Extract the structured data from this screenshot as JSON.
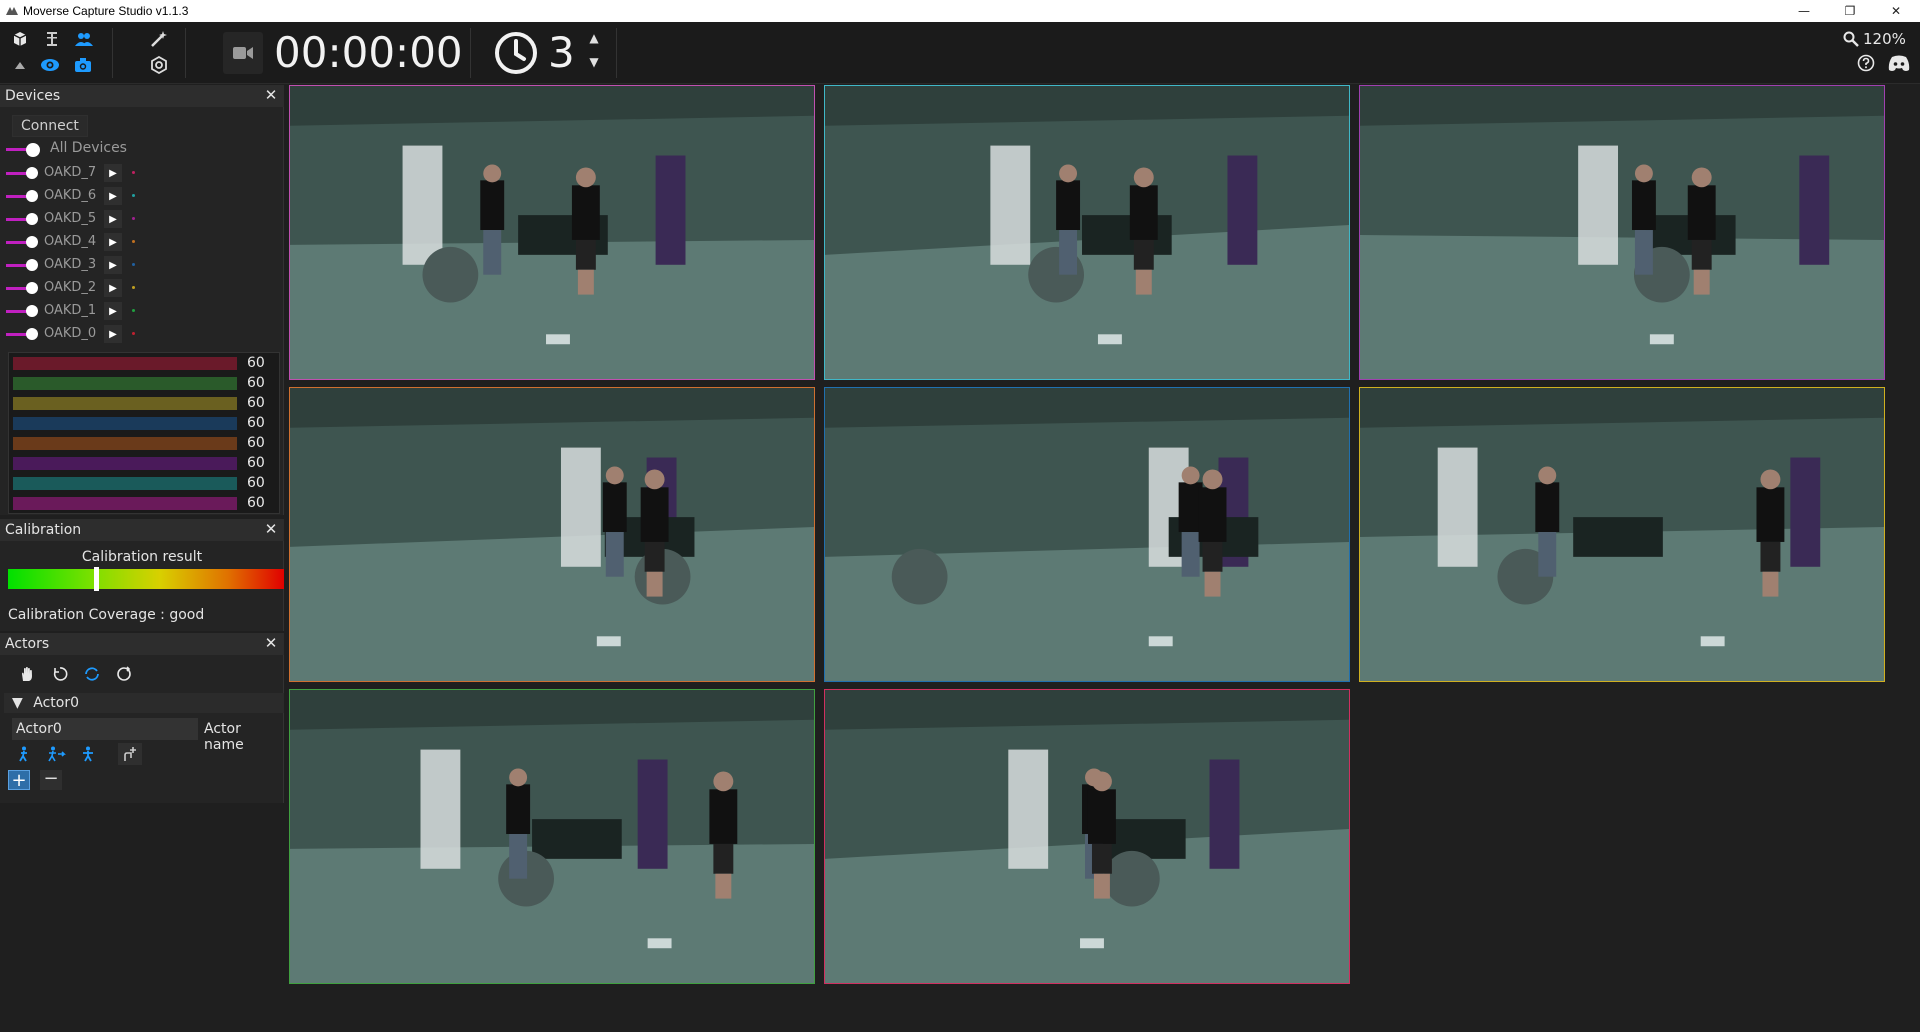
{
  "window": {
    "title": "Moverse Capture Studio v1.1.3",
    "minimize": "—",
    "restore": "❐",
    "close": "✕"
  },
  "toolbar": {
    "timer": "00:00:00",
    "countdown": "3",
    "zoom": "120%"
  },
  "devices": {
    "title": "Devices",
    "connect_label": "Connect",
    "all_label": "All Devices",
    "items": [
      {
        "label": "OAKD_7",
        "dot": "#c02060"
      },
      {
        "label": "OAKD_6",
        "dot": "#20a0a0"
      },
      {
        "label": "OAKD_5",
        "dot": "#a02090"
      },
      {
        "label": "OAKD_4",
        "dot": "#c07020"
      },
      {
        "label": "OAKD_3",
        "dot": "#2060a0"
      },
      {
        "label": "OAKD_2",
        "dot": "#c0a020"
      },
      {
        "label": "OAKD_1",
        "dot": "#20a040"
      },
      {
        "label": "OAKD_0",
        "dot": "#c02030"
      }
    ],
    "fps": [
      {
        "value": "60",
        "color": "#6a1a2a"
      },
      {
        "value": "60",
        "color": "#2a5a2a"
      },
      {
        "value": "60",
        "color": "#6a6020"
      },
      {
        "value": "60",
        "color": "#1a3a5a"
      },
      {
        "value": "60",
        "color": "#6a3a1a"
      },
      {
        "value": "60",
        "color": "#4a1a5a"
      },
      {
        "value": "60",
        "color": "#1a5a5a"
      },
      {
        "value": "60",
        "color": "#6a1a5a"
      }
    ]
  },
  "calibration": {
    "title": "Calibration",
    "result_label": "Calibration result",
    "result_level": 0.32,
    "coverage": "Calibration Coverage : good"
  },
  "actors": {
    "title": "Actors",
    "actor_tree_label": "Actor0",
    "actor_name_value": "Actor0",
    "actor_name_label": "Actor name"
  },
  "cameras": [
    {
      "border": "#c050b0"
    },
    {
      "border": "#40b8c8"
    },
    {
      "border": "#a040b0"
    },
    {
      "border": "#d07030"
    },
    {
      "border": "#2070b0"
    },
    {
      "border": "#d0b020"
    },
    {
      "border": "#40a040"
    },
    {
      "border": "#d03060"
    }
  ],
  "colors": {
    "accent": "#1e9bff",
    "toggle_track": "#c020c0"
  }
}
